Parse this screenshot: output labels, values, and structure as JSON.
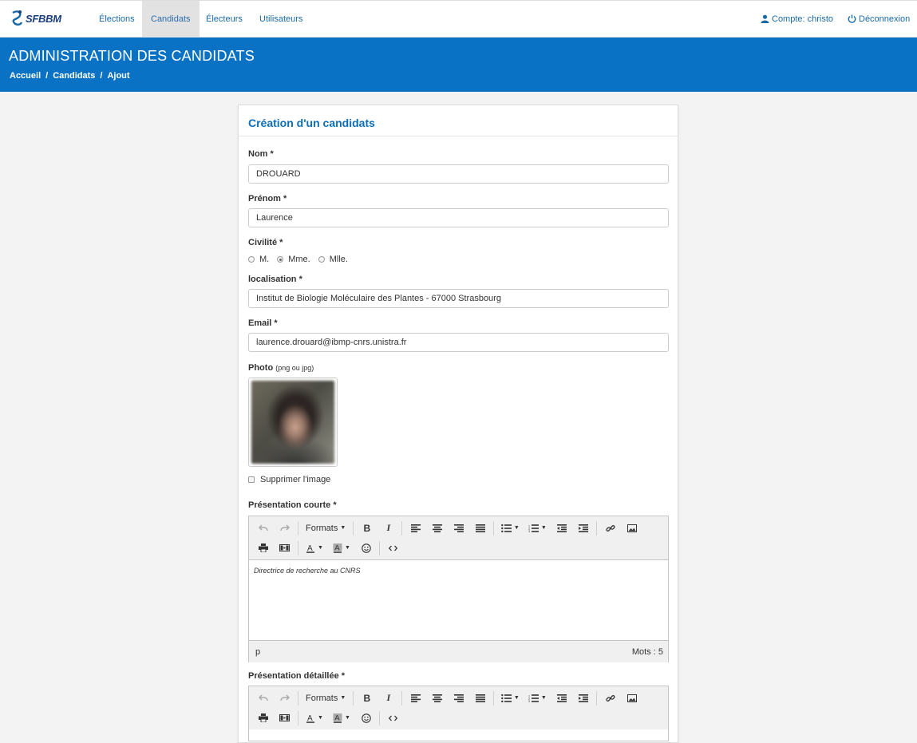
{
  "nav": {
    "brand": "SFBBM",
    "items": [
      "Élections",
      "Candidats",
      "Électeurs",
      "Utilisateurs"
    ],
    "active_index": 1,
    "account": "Compte: christo",
    "logout": "Déconnexion"
  },
  "header": {
    "title": "ADMINISTRATION DES CANDIDATS",
    "breadcrumbs": [
      "Accueil",
      "Candidats",
      "Ajout"
    ]
  },
  "form": {
    "title": "Création d'un candidats",
    "nom_label": "Nom *",
    "nom_value": "DROUARD",
    "prenom_label": "Prénom *",
    "prenom_value": "Laurence",
    "civilite_label": "Civilité *",
    "civilite_options": [
      "M.",
      "Mme.",
      "Mlle."
    ],
    "civilite_selected": "Mme.",
    "localisation_label": "localisation *",
    "localisation_value": "Institut de Biologie Moléculaire des Plantes - 67000 Strasbourg",
    "email_label": "Email *",
    "email_value": "laurence.drouard@ibmp-cnrs.unistra.fr",
    "photo_label": "Photo",
    "photo_hint": "(png ou jpg)",
    "delete_image_label": "Supprimer l'image",
    "short_presentation_label": "Présentation courte *",
    "short_presentation_text": "Directrice de recherche au CNRS",
    "short_status_path": "p",
    "short_word_count": "Mots : 5",
    "detailed_presentation_label": "Présentation détaillée *"
  },
  "editor_toolbar": {
    "formats_label": "Formats"
  },
  "colors": {
    "band": "#0a72c4",
    "link": "#1a6aa8",
    "card_title": "#0d6db6"
  }
}
